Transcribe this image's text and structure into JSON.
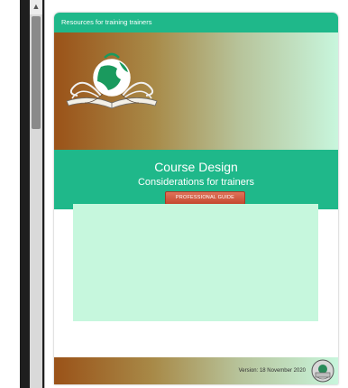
{
  "document": {
    "header_text": "Resources for training trainers",
    "title": "Course Design",
    "subtitle": "Considerations for trainers",
    "badge": "PROFESSIONAL GUIDE",
    "version": "Version: 18 November 2020"
  },
  "icons": {
    "scroll_up": "triangle-up",
    "logo": "globe-tree-book-logo",
    "footer_logo": "round-emblem-logo"
  },
  "colors": {
    "accent_green": "#1fb88a",
    "gradient_start": "#9a5218",
    "gradient_end": "#c8f6dd",
    "content_box": "#c6f7dd",
    "badge_red": "#c4482f"
  }
}
